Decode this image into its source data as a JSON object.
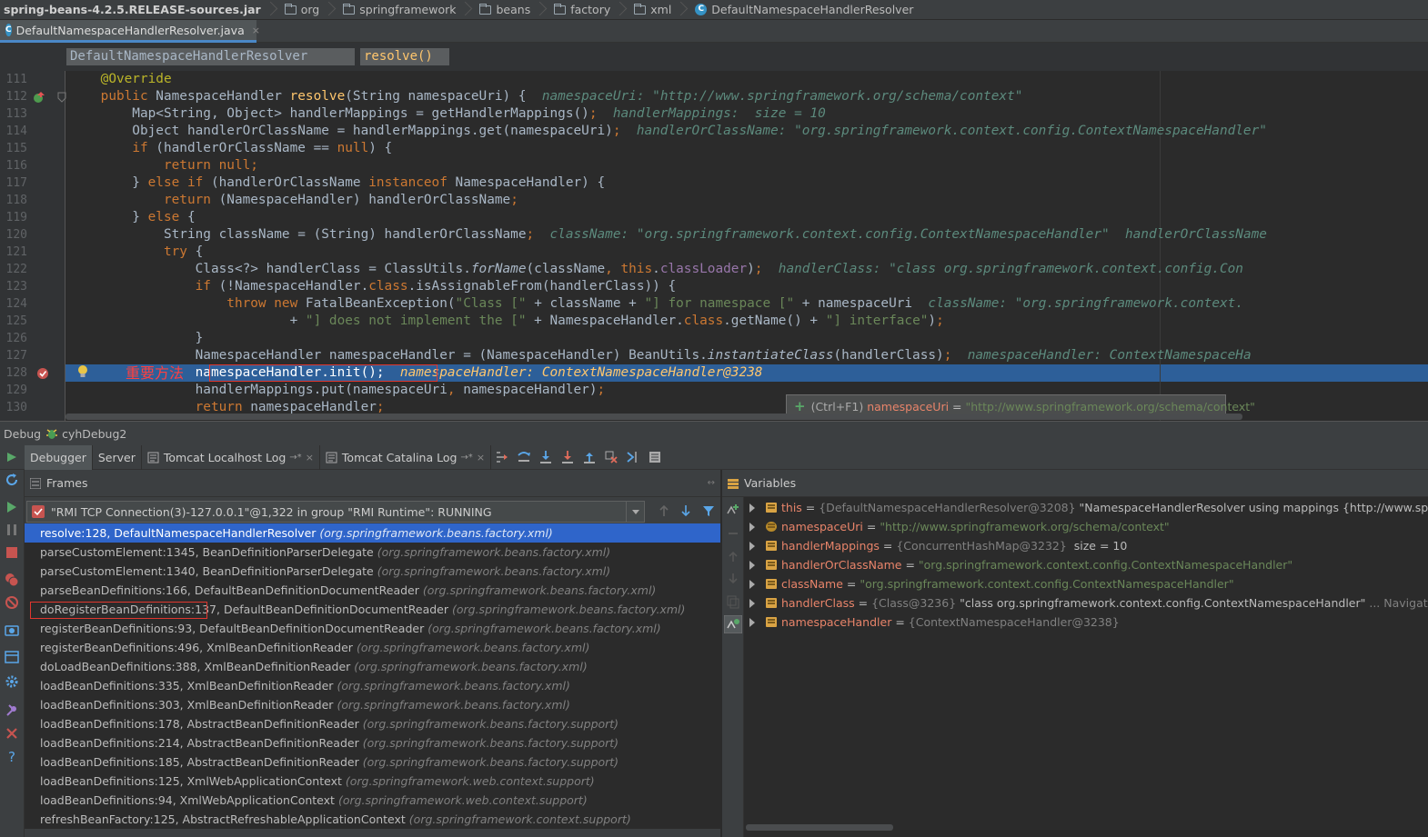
{
  "nav_bar": {
    "root": "spring-beans-4.2.5.RELEASE-sources.jar",
    "folders": [
      "org",
      "springframework",
      "beans",
      "factory",
      "xml"
    ],
    "class_name": "DefaultNamespaceHandlerResolver"
  },
  "file_tab": {
    "label": "DefaultNamespaceHandlerResolver.java",
    "close": "×"
  },
  "method_breadcrumb": {
    "class": "DefaultNamespaceHandlerResolver",
    "method": "resolve()"
  },
  "code": {
    "line_numbers": [
      "111",
      "112",
      "113",
      "114",
      "115",
      "116",
      "117",
      "118",
      "119",
      "120",
      "121",
      "122",
      "123",
      "124",
      "125",
      "126",
      "127",
      "128",
      "129",
      "130"
    ],
    "inline_values": {
      "l112": "namespaceUri: \"http://www.springframework.org/schema/context\"",
      "l113": "handlerMappings:  size = 10",
      "l114": "handlerOrClassName: \"org.springframework.context.config.ContextNamespaceHandler\"",
      "l120": "className: \"org.springframework.context.config.ContextNamespaceHandler\"  handlerOrClassName",
      "l122": "handlerClass: \"class org.springframework.context.config.Con",
      "l124": "className: \"org.springframework.context.",
      "l127": "namespaceHandler: ContextNamespaceHa",
      "l128": "namespaceHandler: ContextNamespaceHandler@3238"
    },
    "annotation_text": "重要方法"
  },
  "tooltip": {
    "prefix": "(Ctrl+F1)",
    "name": "namespaceUri",
    "eq": " = ",
    "value": "\"http://www.springframework.org/schema/context\""
  },
  "debug_bar": {
    "label": "Debug",
    "config": "cyhDebug2"
  },
  "debug_tabs": {
    "debugger": "Debugger",
    "server": "Server",
    "tomcat_localhost": "Tomcat Localhost Log",
    "tomcat_catalina": "Tomcat Catalina Log",
    "pin": "→*",
    "close": "×"
  },
  "frames_panel": {
    "title": "Frames",
    "thread": "\"RMI TCP Connection(3)-127.0.0.1\"@1,322 in group \"RMI Runtime\": RUNNING",
    "items": [
      {
        "m": "resolve:128, DefaultNamespaceHandlerResolver",
        "p": "(org.springframework.beans.factory.xml)"
      },
      {
        "m": "parseCustomElement:1345, BeanDefinitionParserDelegate",
        "p": "(org.springframework.beans.factory.xml)"
      },
      {
        "m": "parseCustomElement:1340, BeanDefinitionParserDelegate",
        "p": "(org.springframework.beans.factory.xml)"
      },
      {
        "m": "parseBeanDefinitions:166, DefaultBeanDefinitionDocumentReader",
        "p": "(org.springframework.beans.factory.xml)"
      },
      {
        "m": "doRegisterBeanDefinitions:137, DefaultBeanDefinitionDocumentReader",
        "p": "(org.springframework.beans.factory.xml)"
      },
      {
        "m": "registerBeanDefinitions:93, DefaultBeanDefinitionDocumentReader",
        "p": "(org.springframework.beans.factory.xml)"
      },
      {
        "m": "registerBeanDefinitions:496, XmlBeanDefinitionReader",
        "p": "(org.springframework.beans.factory.xml)"
      },
      {
        "m": "doLoadBeanDefinitions:388, XmlBeanDefinitionReader",
        "p": "(org.springframework.beans.factory.xml)"
      },
      {
        "m": "loadBeanDefinitions:335, XmlBeanDefinitionReader",
        "p": "(org.springframework.beans.factory.xml)"
      },
      {
        "m": "loadBeanDefinitions:303, XmlBeanDefinitionReader",
        "p": "(org.springframework.beans.factory.xml)"
      },
      {
        "m": "loadBeanDefinitions:178, AbstractBeanDefinitionReader",
        "p": "(org.springframework.beans.factory.support)"
      },
      {
        "m": "loadBeanDefinitions:214, AbstractBeanDefinitionReader",
        "p": "(org.springframework.beans.factory.support)"
      },
      {
        "m": "loadBeanDefinitions:185, AbstractBeanDefinitionReader",
        "p": "(org.springframework.beans.factory.support)"
      },
      {
        "m": "loadBeanDefinitions:125, XmlWebApplicationContext",
        "p": "(org.springframework.web.context.support)"
      },
      {
        "m": "loadBeanDefinitions:94, XmlWebApplicationContext",
        "p": "(org.springframework.web.context.support)"
      },
      {
        "m": "refreshBeanFactory:125, AbstractRefreshableApplicationContext",
        "p": "(org.springframework.context.support)"
      }
    ]
  },
  "variables_panel": {
    "title": "Variables",
    "items": [
      {
        "name": "this",
        "eq": " = ",
        "type": "{DefaultNamespaceHandlerResolver@3208}",
        "value": " \"NamespaceHandlerResolver using mappings {http://www.springframe",
        "extra": ""
      },
      {
        "name": "namespaceUri",
        "eq": " = ",
        "type": "",
        "value": "\"http://www.springframework.org/schema/context\"",
        "extra": ""
      },
      {
        "name": "handlerMappings",
        "eq": " = ",
        "type": "{ConcurrentHashMap@3232}",
        "value": "  size = 10",
        "extra": ""
      },
      {
        "name": "handlerOrClassName",
        "eq": " = ",
        "type": "",
        "value": "\"org.springframework.context.config.ContextNamespaceHandler\"",
        "extra": ""
      },
      {
        "name": "className",
        "eq": " = ",
        "type": "",
        "value": "\"org.springframework.context.config.ContextNamespaceHandler\"",
        "extra": ""
      },
      {
        "name": "handlerClass",
        "eq": " = ",
        "type": "{Class@3236}",
        "value": " \"class org.springframework.context.config.ContextNamespaceHandler\"",
        "extra": "... Navigate"
      },
      {
        "name": "namespaceHandler",
        "eq": " = ",
        "type": "{ContextNamespaceHandler@3238}",
        "value": "",
        "extra": ""
      }
    ]
  }
}
